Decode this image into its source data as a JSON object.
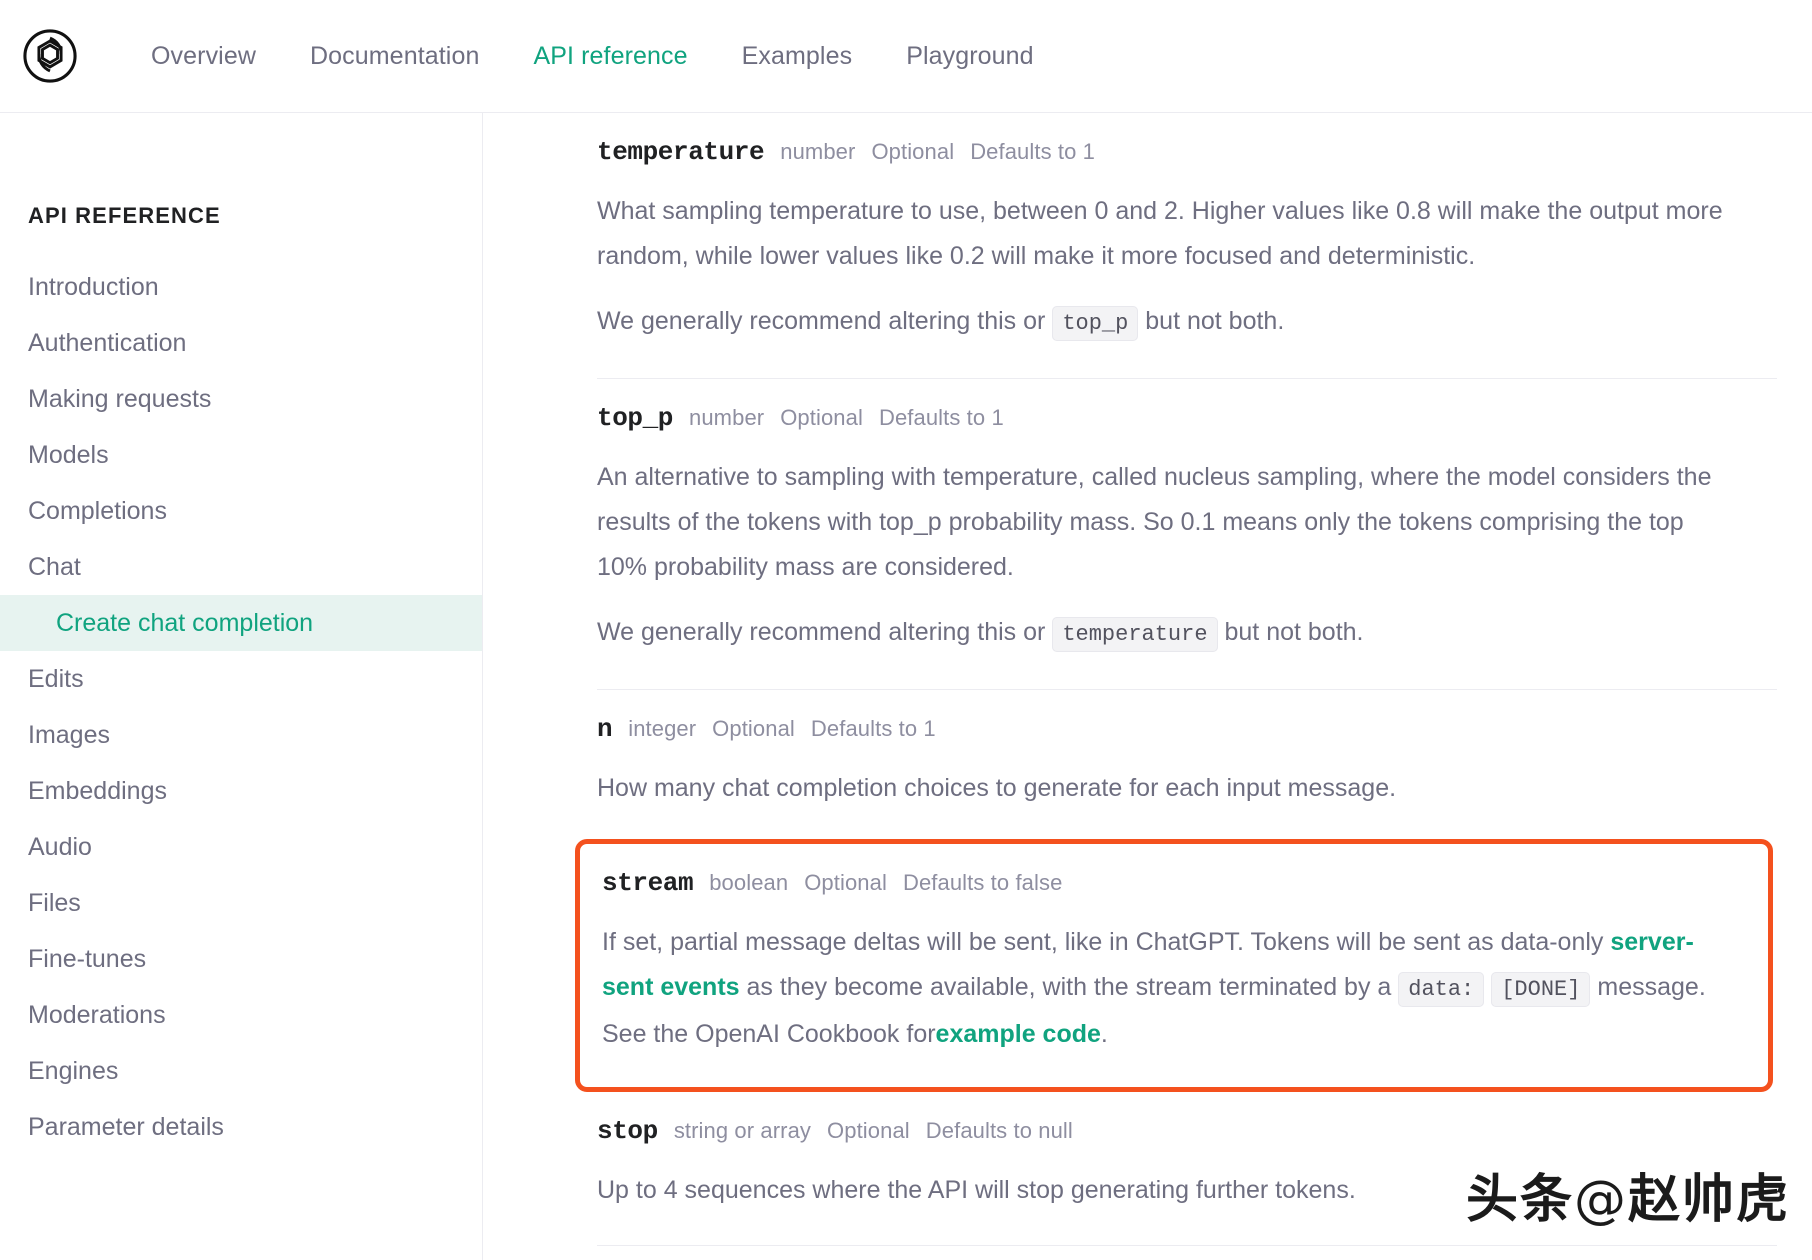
{
  "topnav": {
    "logo_icon": "openai-logo-icon",
    "items": [
      {
        "label": "Overview",
        "active": false
      },
      {
        "label": "Documentation",
        "active": false
      },
      {
        "label": "API reference",
        "active": true
      },
      {
        "label": "Examples",
        "active": false
      },
      {
        "label": "Playground",
        "active": false
      }
    ],
    "accent_color": "#10a37f"
  },
  "sidebar": {
    "title": "API REFERENCE",
    "items": [
      {
        "label": "Introduction",
        "sub": false,
        "active": false
      },
      {
        "label": "Authentication",
        "sub": false,
        "active": false
      },
      {
        "label": "Making requests",
        "sub": false,
        "active": false
      },
      {
        "label": "Models",
        "sub": false,
        "active": false
      },
      {
        "label": "Completions",
        "sub": false,
        "active": false
      },
      {
        "label": "Chat",
        "sub": false,
        "active": false
      },
      {
        "label": "Create chat completion",
        "sub": true,
        "active": true
      },
      {
        "label": "Edits",
        "sub": false,
        "active": false
      },
      {
        "label": "Images",
        "sub": false,
        "active": false
      },
      {
        "label": "Embeddings",
        "sub": false,
        "active": false
      },
      {
        "label": "Audio",
        "sub": false,
        "active": false
      },
      {
        "label": "Files",
        "sub": false,
        "active": false
      },
      {
        "label": "Fine-tunes",
        "sub": false,
        "active": false
      },
      {
        "label": "Moderations",
        "sub": false,
        "active": false
      },
      {
        "label": "Engines",
        "sub": false,
        "active": false
      },
      {
        "label": "Parameter details",
        "sub": false,
        "active": false
      }
    ],
    "active_bg": "#e7f3f0",
    "active_color": "#10a37f"
  },
  "main": {
    "temperature": {
      "name": "temperature",
      "type": "number",
      "required": "Optional",
      "defaults": "Defaults to 1",
      "desc": "What sampling temperature to use, between 0 and 2. Higher values like 0.8 will make the output more random, while lower values like 0.2 will make it more focused and deterministic.",
      "note_pre": "We generally recommend altering this or",
      "note_code": "top_p",
      "note_post": "but not both."
    },
    "top_p": {
      "name": "top_p",
      "type": "number",
      "required": "Optional",
      "defaults": "Defaults to 1",
      "desc": "An alternative to sampling with temperature, called nucleus sampling, where the model considers the results of the tokens with top_p probability mass. So 0.1 means only the tokens comprising the top 10% probability mass are considered.",
      "note_pre": "We generally recommend altering this or",
      "note_code": "temperature",
      "note_post": "but not both."
    },
    "n": {
      "name": "n",
      "type": "integer",
      "required": "Optional",
      "defaults": "Defaults to 1",
      "desc": "How many chat completion choices to generate for each input message."
    },
    "stream": {
      "name": "stream",
      "type": "boolean",
      "required": "Optional",
      "defaults": "Defaults to false",
      "desc_part1": "If set, partial message deltas will be sent, like in ChatGPT. Tokens will be sent as data-only",
      "link1": "server-sent events",
      "desc_part2": "as they become available, with the stream terminated by a",
      "code1": "data:",
      "code2": "[DONE]",
      "desc_part3": "message. See the OpenAI Cookbook for",
      "link2": "example code",
      "desc_part4": ".",
      "highlight_color": "#f4511e"
    },
    "stop": {
      "name": "stop",
      "type": "string or array",
      "required": "Optional",
      "defaults": "Defaults to null",
      "desc": "Up to 4 sequences where the API will stop generating further tokens."
    }
  },
  "watermark": {
    "brand": "头条",
    "at": "@",
    "handle": "赵帅虎"
  }
}
